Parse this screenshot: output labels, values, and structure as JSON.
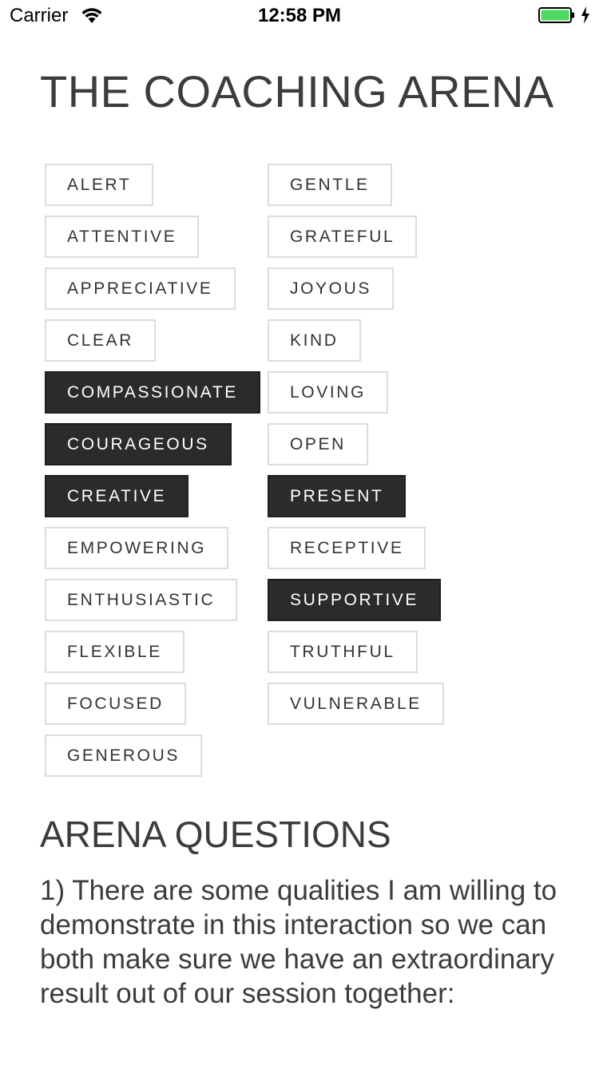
{
  "status_bar": {
    "carrier": "Carrier",
    "time": "12:58 PM",
    "wifi_icon": "wifi-icon",
    "battery_icon": "battery-charging-icon",
    "battery_color": "#4cd964"
  },
  "page": {
    "title": "THE COACHING ARENA"
  },
  "qualities": {
    "left": [
      {
        "label": "ALERT",
        "selected": false
      },
      {
        "label": "ATTENTIVE",
        "selected": false
      },
      {
        "label": "APPRECIATIVE",
        "selected": false
      },
      {
        "label": "CLEAR",
        "selected": false
      },
      {
        "label": "COMPASSIONATE",
        "selected": true
      },
      {
        "label": "COURAGEOUS",
        "selected": true
      },
      {
        "label": "CREATIVE",
        "selected": true
      },
      {
        "label": "EMPOWERING",
        "selected": false
      },
      {
        "label": "ENTHUSIASTIC",
        "selected": false
      },
      {
        "label": "FLEXIBLE",
        "selected": false
      },
      {
        "label": "FOCUSED",
        "selected": false
      },
      {
        "label": "GENEROUS",
        "selected": false
      }
    ],
    "right": [
      {
        "label": "GENTLE",
        "selected": false
      },
      {
        "label": "GRATEFUL",
        "selected": false
      },
      {
        "label": "JOYOUS",
        "selected": false
      },
      {
        "label": "KIND",
        "selected": false
      },
      {
        "label": "LOVING",
        "selected": false
      },
      {
        "label": "OPEN",
        "selected": false
      },
      {
        "label": "PRESENT",
        "selected": true
      },
      {
        "label": "RECEPTIVE",
        "selected": false
      },
      {
        "label": "SUPPORTIVE",
        "selected": true
      },
      {
        "label": "TRUTHFUL",
        "selected": false
      },
      {
        "label": "VULNERABLE",
        "selected": false
      }
    ],
    "selected_color": "#2b2b2b",
    "border_color": "#dcdcdc"
  },
  "questions": {
    "title": "ARENA QUESTIONS",
    "q1": "1) There are some qualities I am willing to demonstrate in this interaction so we can both make sure we have an extraordinary result out of our session together:"
  }
}
